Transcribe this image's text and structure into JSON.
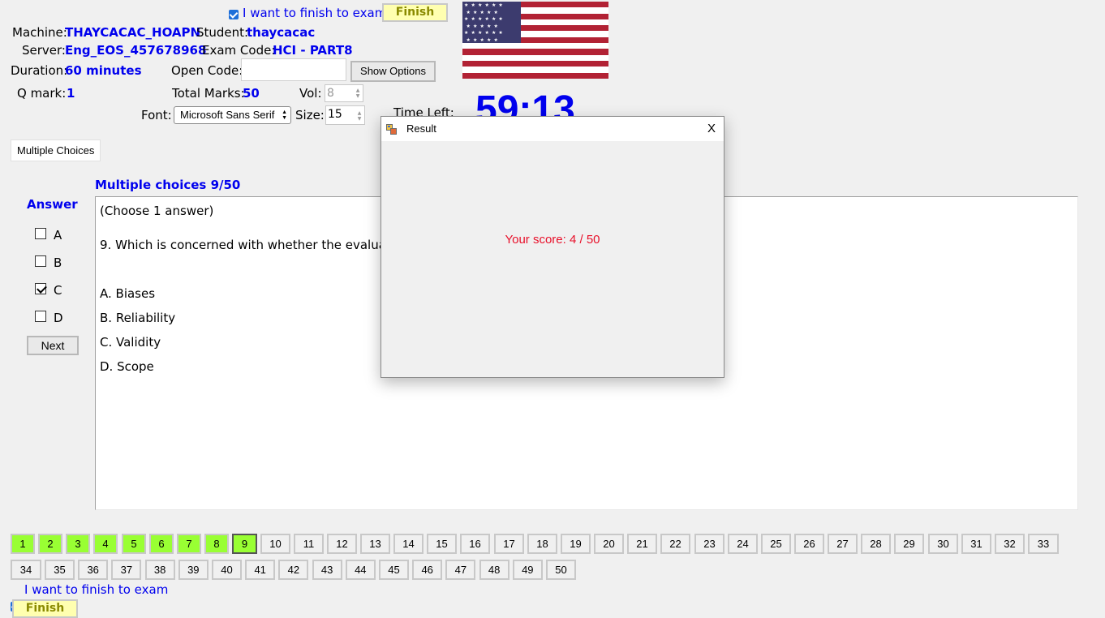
{
  "header": {
    "finish_checkbox_label": "I want to finish to exam",
    "finish_label": "Finish",
    "machine_label": "Machine:",
    "machine_value": "THAYCACAC_HOAPN",
    "student_label": "Student:",
    "student_value": "thaycacac",
    "server_label": "Server:",
    "server_value": "Eng_EOS_457678968",
    "exam_code_label": "Exam Code:",
    "exam_code_value": "HCI - PART8",
    "duration_label": "Duration:",
    "duration_value": "60 minutes",
    "open_code_label": "Open Code:",
    "open_code_value": "",
    "show_options_label": "Show Options",
    "q_mark_label": "Q mark:",
    "q_mark_value": "1",
    "total_marks_label": "Total Marks:",
    "total_marks_value": "50",
    "vol_label": "Vol:",
    "vol_value": "8",
    "font_label": "Font:",
    "font_value": "Microsoft Sans Serif",
    "size_label": "Size:",
    "size_value": "15",
    "time_left_label": "Time Left:",
    "time_left_value": "59:13"
  },
  "tab": {
    "label": "Multiple Choices"
  },
  "question": {
    "heading": "Multiple choices 9/50",
    "instruction": "(Choose 1 answer)",
    "text": "9. Which is concerned with whether the evaluation",
    "options": [
      "A. Biases",
      "B. Reliability",
      "C. Validity",
      "D. Scope"
    ]
  },
  "answer": {
    "title": "Answer",
    "choices": [
      {
        "label": "A",
        "checked": false
      },
      {
        "label": "B",
        "checked": false
      },
      {
        "label": "C",
        "checked": true
      },
      {
        "label": "D",
        "checked": false
      }
    ],
    "next_label": "Next"
  },
  "navigation": {
    "current": 9,
    "answered": [
      1,
      2,
      3,
      4,
      5,
      6,
      7,
      8,
      9
    ],
    "row1": [
      "1",
      "2",
      "3",
      "4",
      "5",
      "6",
      "7",
      "8",
      "9",
      "10",
      "11",
      "12",
      "13",
      "14",
      "15",
      "16",
      "17",
      "18",
      "19",
      "20",
      "21",
      "22",
      "23",
      "24",
      "25",
      "26",
      "27",
      "28",
      "29",
      "30",
      "31",
      "32",
      "33"
    ],
    "row2": [
      "34",
      "35",
      "36",
      "37",
      "38",
      "39",
      "40",
      "41",
      "42",
      "43",
      "44",
      "45",
      "46",
      "47",
      "48",
      "49",
      "50"
    ]
  },
  "footer": {
    "finish_checkbox_label": "I want to finish to exam",
    "finish_label": "Finish"
  },
  "dialog": {
    "title": "Result",
    "close_label": "X",
    "score_text": "Your score: 4 / 50"
  },
  "colors": {
    "value_blue": "#0000ee",
    "answered_green": "#99ff33",
    "finish_yellow": "#ffffb0",
    "score_red": "#e8102a"
  }
}
